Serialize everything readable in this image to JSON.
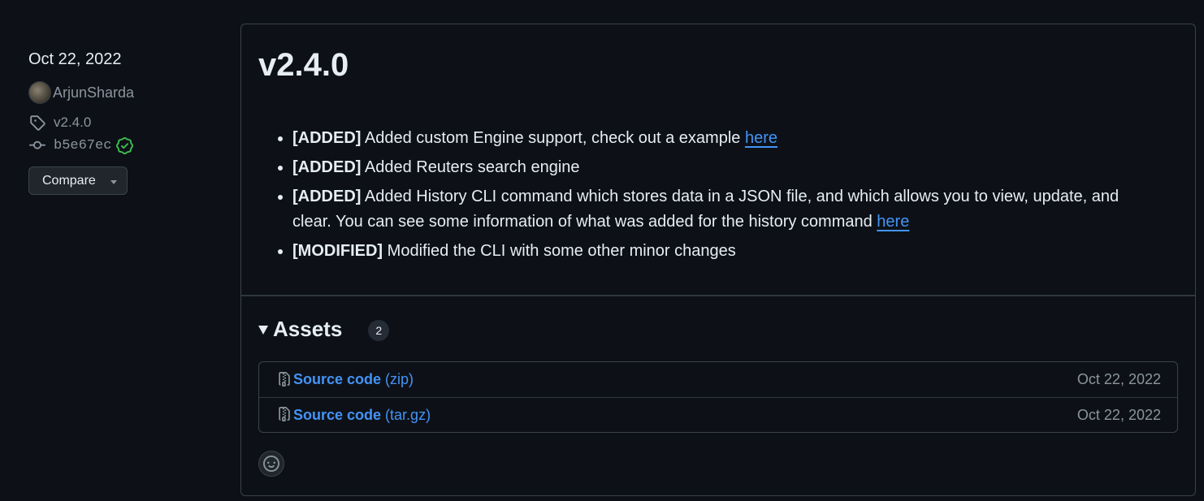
{
  "sidebar": {
    "date": "Oct 22, 2022",
    "author": "ArjunSharda",
    "tag": "v2.4.0",
    "commit": "b5e67ec",
    "compare_label": "Compare"
  },
  "release": {
    "title": "v2.4.0",
    "notes": [
      {
        "prefix": "[ADDED]",
        "text": "Added custom Engine support, check out a example ",
        "link": "here"
      },
      {
        "prefix": "[ADDED]",
        "text": "Added Reuters search engine",
        "link": ""
      },
      {
        "prefix": "[ADDED]",
        "text": "Added History CLI command which stores data in a JSON file, and which allows you to view, update, and clear. You can see some information of what was added for the history command ",
        "link": "here"
      },
      {
        "prefix": "[MODIFIED]",
        "text": "Modified the CLI with some other minor changes",
        "link": ""
      }
    ]
  },
  "assets": {
    "title": "Assets",
    "count": "2",
    "items": [
      {
        "name": "Source code",
        "ext": "(zip)",
        "date": "Oct 22, 2022"
      },
      {
        "name": "Source code",
        "ext": "(tar.gz)",
        "date": "Oct 22, 2022"
      }
    ]
  },
  "colors": {
    "background": "#0d1117",
    "text": "#e6edf3",
    "muted": "#8b949e",
    "link": "#4493f8",
    "border": "#3b424c",
    "verified": "#3fb950"
  },
  "icons": [
    "tag-icon",
    "commit-icon",
    "verified-icon",
    "file-zip-icon",
    "smiley-icon"
  ]
}
